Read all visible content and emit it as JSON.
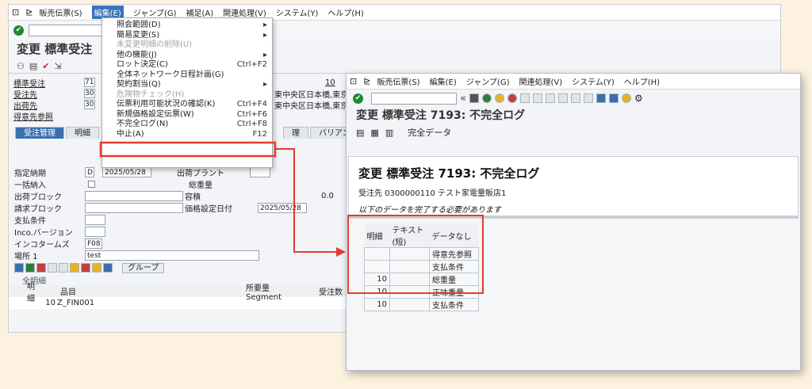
{
  "back": {
    "menu": [
      "販売伝票(S)",
      "編集(E)",
      "ジャンプ(G)",
      "補足(A)",
      "関連処理(V)",
      "システム(Y)",
      "ヘルプ(H)"
    ],
    "title": "変更 標準受注",
    "header_rows": [
      {
        "label": "標準受注",
        "value": "71",
        "right": "10"
      },
      {
        "label": "受注先",
        "value": "30",
        "right": "東中央区日本橋,東京"
      },
      {
        "label": "出荷先",
        "value": "30",
        "right": "東中央区日本橋,東京"
      },
      {
        "label": "得意先参照",
        "value": "",
        "right": ""
      }
    ],
    "tabs": [
      "受注管理",
      "明細",
      "理",
      "バリアント選択"
    ],
    "fields": [
      {
        "label": "指定納期",
        "value": "D",
        "value2": "2025/05/28",
        "rlabel": "出荷プラント",
        "rvalue": ""
      },
      {
        "label": "一括納入",
        "value": "",
        "value2": "",
        "rlabel": "総重量",
        "rvalue": ""
      },
      {
        "label": "出荷ブロック",
        "value": "",
        "value2": "",
        "rlabel": "容積",
        "rvalue": "0.0"
      },
      {
        "label": "請求ブロック",
        "value": "",
        "value2": "",
        "rlabel": "価格設定日付",
        "rvalue": "2025/05/28"
      },
      {
        "label": "支払条件",
        "value": "",
        "value2": "",
        "rlabel": "",
        "rvalue": ""
      },
      {
        "label": "Inco.バージョン",
        "value": "",
        "value2": "",
        "rlabel": "",
        "rvalue": ""
      },
      {
        "label": "インコタームズ",
        "value": "F08",
        "value2": "",
        "rlabel": "",
        "rvalue": ""
      },
      {
        "label": "場所 1",
        "value": "test",
        "value2": "",
        "rlabel": "",
        "rvalue": ""
      }
    ],
    "group_button": "グループ",
    "all_items": "全明細",
    "item_cols": [
      "明細",
      "品目",
      "所要量 Segment",
      "受注数"
    ],
    "item_row": {
      "item": "10",
      "material": "Z_FIN001"
    }
  },
  "menu": {
    "items": [
      {
        "label": "照会範囲(D)",
        "acc": "▸",
        "disabled": false
      },
      {
        "label": "簡易変更(S)",
        "acc": "▸",
        "disabled": false
      },
      {
        "label": "未変更明細の削除(U)",
        "acc": "",
        "disabled": true
      },
      {
        "label": "他の機能(J)",
        "acc": "▸",
        "disabled": false
      },
      {
        "label": "ロット決定(C)",
        "acc": "Ctrl+F2",
        "disabled": false
      },
      {
        "label": "全体ネットワーク日程計画(G)",
        "acc": "",
        "disabled": false
      },
      {
        "label": "契約割当(Q)",
        "acc": "▸",
        "disabled": false
      },
      {
        "label": "危険物チェック(H)",
        "acc": "",
        "disabled": true
      },
      {
        "label": "伝票利用可能状況の確認(K)",
        "acc": "Ctrl+F4",
        "disabled": false
      },
      {
        "label": "新規価格設定伝票(W)",
        "acc": "Ctrl+F6",
        "disabled": false
      },
      {
        "label": "不完全ログ(N)",
        "acc": "Ctrl+F8",
        "disabled": false
      },
      {
        "label": "中止(A)",
        "acc": "F12",
        "disabled": false
      }
    ]
  },
  "front": {
    "menu": [
      "販売伝票(S)",
      "編集(E)",
      "ジャンプ(G)",
      "関連処理(V)",
      "システム(Y)",
      "ヘルプ(H)"
    ],
    "title": "変更 標準受注 7193: 不完全ログ",
    "app_button": "完全データ",
    "doc_title": "変更 標準受注 7193: 不完全ログ",
    "customer_label": "受注先",
    "customer_value": "0300000110 テスト家電量販店1",
    "note": "以下のデータを完了する必要があります",
    "grid_headers": [
      "明細",
      "テキスト (短)",
      "データなし"
    ],
    "grid_rows": [
      {
        "item": "",
        "text": "",
        "missing": "得意先参照"
      },
      {
        "item": "",
        "text": "",
        "missing": "支払条件"
      },
      {
        "item": "10",
        "text": "",
        "missing": "総重量"
      },
      {
        "item": "10",
        "text": "",
        "missing": "正味重量"
      },
      {
        "item": "10",
        "text": "",
        "missing": "支払条件"
      }
    ]
  },
  "colors": {
    "highlight": "#e53b2e",
    "ok": "#1e8a2e",
    "tab_active": "#3a6fb0"
  }
}
